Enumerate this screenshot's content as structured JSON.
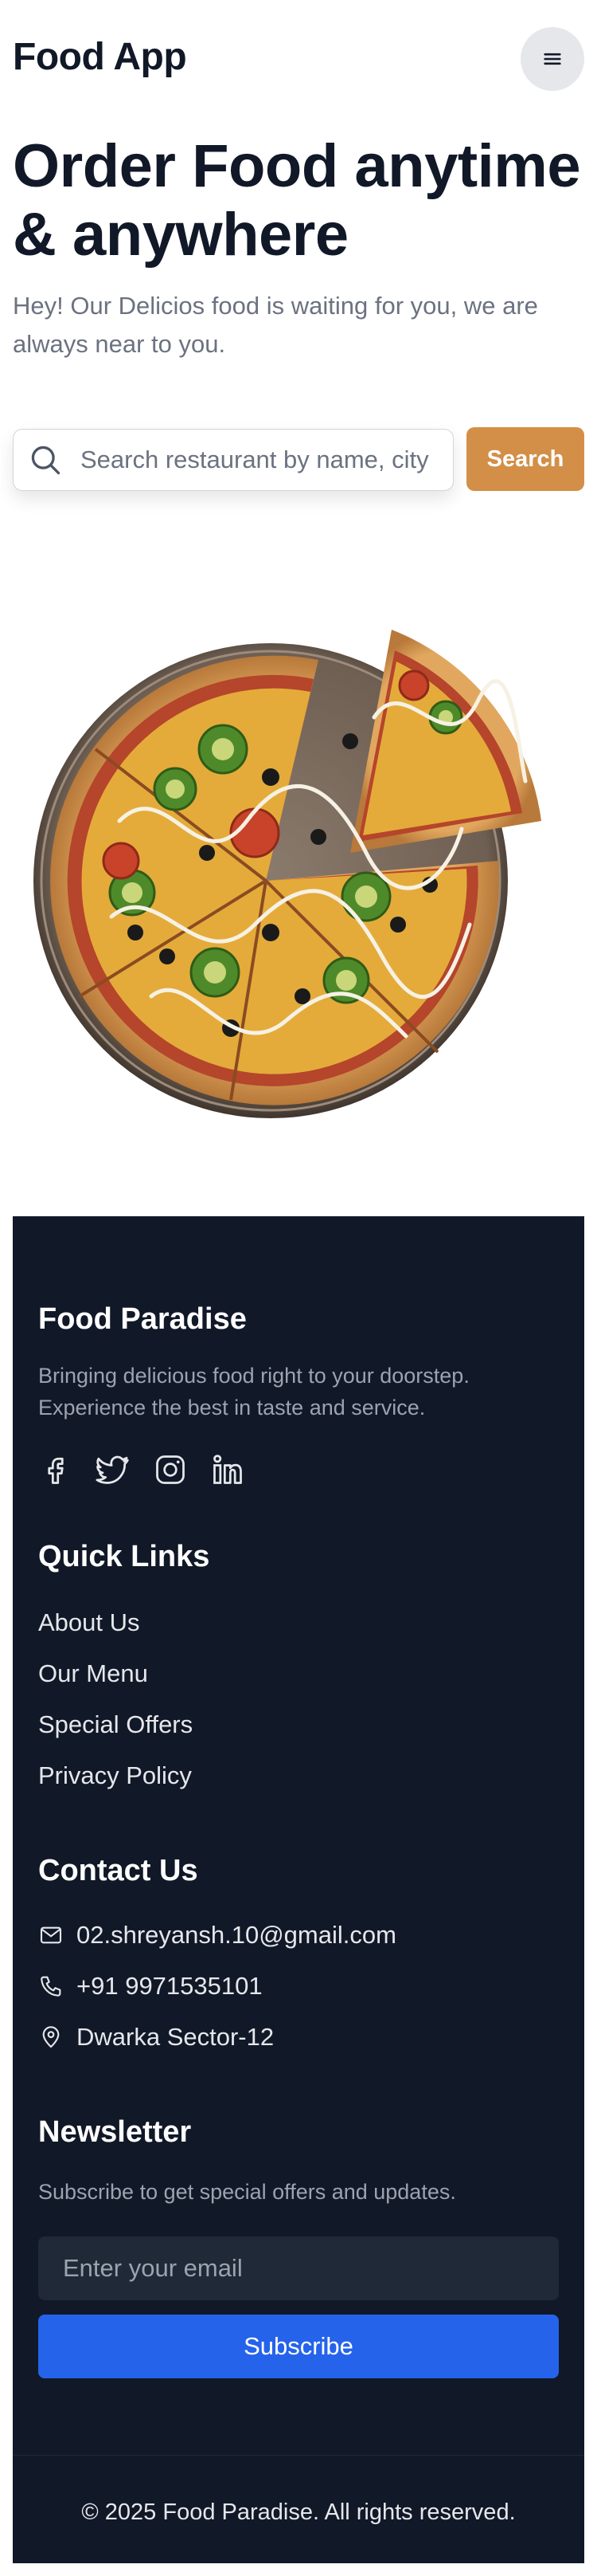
{
  "header": {
    "logo": "Food App",
    "menu_icon": "hamburger-menu-icon"
  },
  "hero": {
    "title": "Order Food anytime & anywhere",
    "subtitle": "Hey! Our Delicios food is waiting for you, we are always near to you."
  },
  "search": {
    "placeholder": "Search restaurant by name, city",
    "button_label": "Search",
    "icon": "search-icon"
  },
  "footer": {
    "brand": "Food Paradise",
    "tagline": "Bringing delicious food right to your doorstep. Experience the best in taste and service.",
    "socials": [
      "facebook-icon",
      "twitter-icon",
      "instagram-icon",
      "linkedin-icon"
    ],
    "quick_links": {
      "title": "Quick Links",
      "items": [
        "About Us",
        "Our Menu",
        "Special Offers",
        "Privacy Policy"
      ]
    },
    "contact": {
      "title": "Contact Us",
      "email": "02.shreyansh.10@gmail.com",
      "phone": "+91 9971535101",
      "address": "Dwarka Sector-12"
    },
    "newsletter": {
      "title": "Newsletter",
      "text": "Subscribe to get special offers and updates.",
      "placeholder": "Enter your email",
      "button_label": "Subscribe"
    },
    "copyright": "© 2025 Food Paradise. All rights reserved."
  },
  "colors": {
    "accent": "#d38f47",
    "footer_bg": "#111827",
    "subscribe_blue": "#2563eb",
    "text_dark": "#111827",
    "text_muted": "#6b7280"
  }
}
